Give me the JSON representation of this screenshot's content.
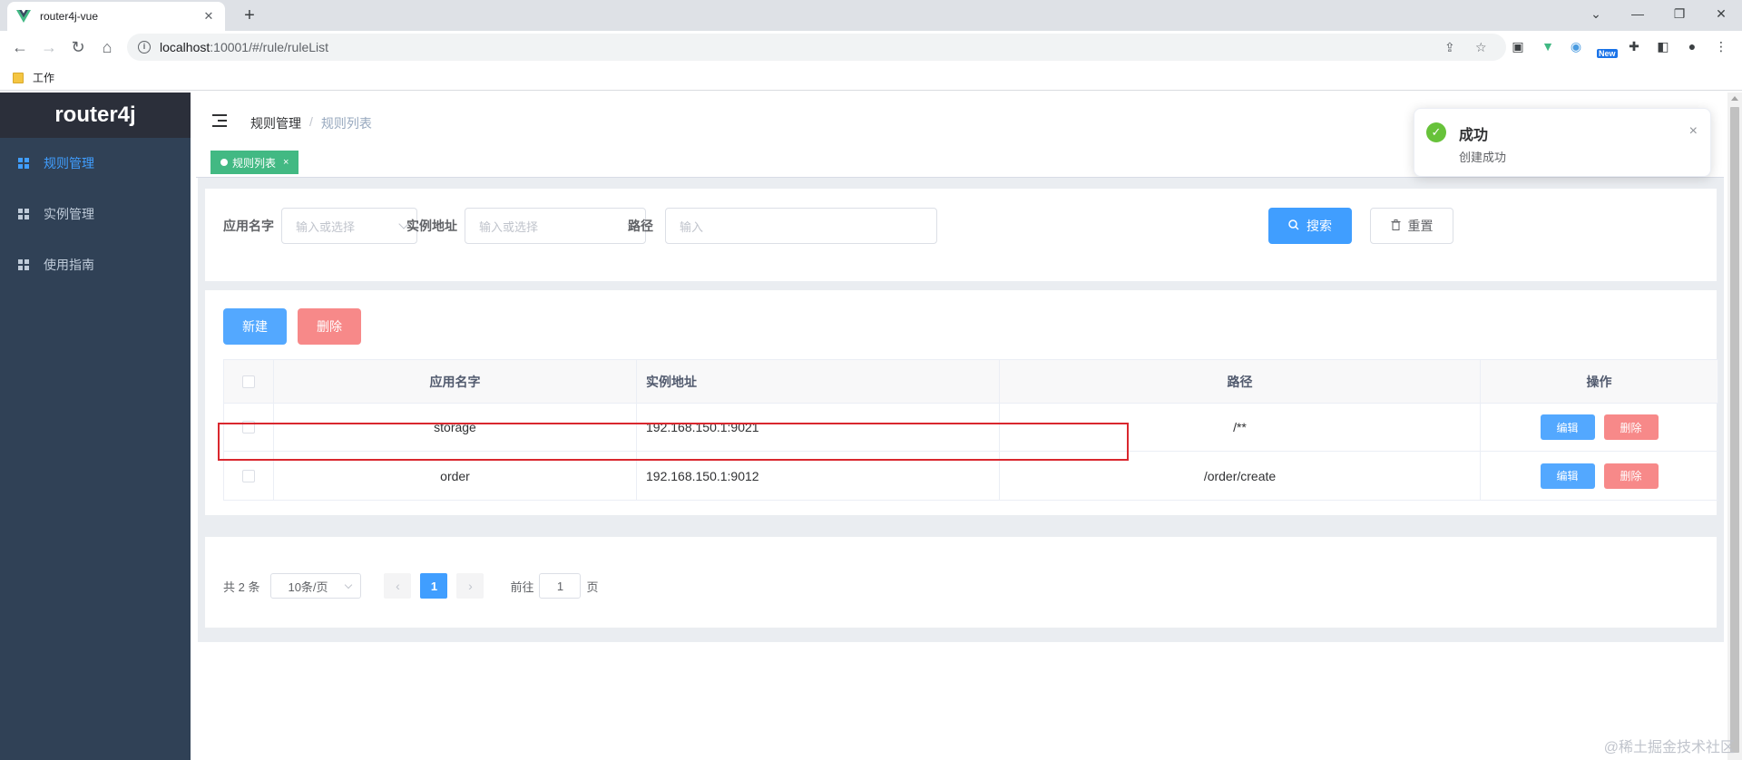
{
  "browser": {
    "tab_title": "router4j-vue",
    "url_host": "localhost",
    "url_rest": ":10001/#/rule/ruleList",
    "bookmark": "工作",
    "new_badge": "New"
  },
  "sidebar": {
    "brand": "router4j",
    "items": [
      {
        "label": "规则管理",
        "active": true
      },
      {
        "label": "实例管理",
        "active": false
      },
      {
        "label": "使用指南",
        "active": false
      }
    ]
  },
  "breadcrumb": {
    "first": "规则管理",
    "separator": "/",
    "last": "规则列表"
  },
  "tags": [
    {
      "label": "规则列表",
      "close": "×"
    }
  ],
  "search": {
    "app_label": "应用名字",
    "app_placeholder": "输入或选择",
    "instance_label": "实例地址",
    "instance_placeholder": "输入或选择",
    "path_label": "路径",
    "path_placeholder": "输入",
    "search_button": "搜索",
    "reset_button": "重置"
  },
  "actions": {
    "create": "新建",
    "delete": "删除"
  },
  "table": {
    "headers": [
      "应用名字",
      "实例地址",
      "路径",
      "操作"
    ],
    "rows": [
      {
        "app": "storage",
        "instance": "192.168.150.1:9021",
        "path": "/**",
        "edit": "编辑",
        "delete": "删除"
      },
      {
        "app": "order",
        "instance": "192.168.150.1:9012",
        "path": "/order/create",
        "edit": "编辑",
        "delete": "删除"
      }
    ]
  },
  "pagination": {
    "total": "共 2 条",
    "page_size": "10条/页",
    "current": "1",
    "goto_prefix": "前往",
    "goto_value": "1",
    "goto_suffix": "页"
  },
  "toast": {
    "title": "成功",
    "message": "创建成功",
    "close": "×"
  },
  "watermark": "@稀土掘金技术社区",
  "colors": {
    "primary": "#409eff",
    "danger": "#f56c6c",
    "success": "#67c23a",
    "sidebar": "#304156",
    "tag": "#42b983"
  }
}
